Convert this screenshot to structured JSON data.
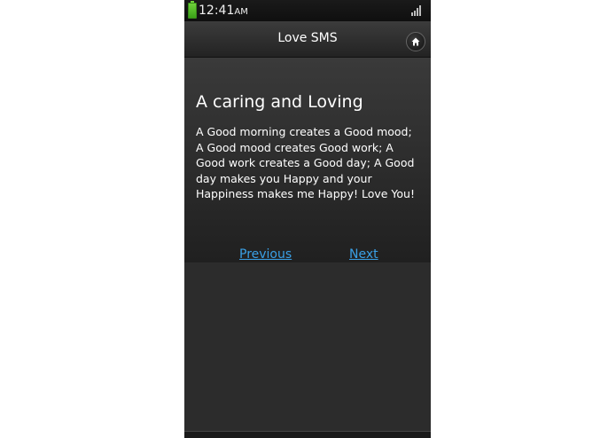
{
  "status_bar": {
    "time": "12:41",
    "ampm": "AM"
  },
  "header": {
    "title": "Love SMS",
    "home_icon": "home-icon"
  },
  "message": {
    "title": "A caring and Loving",
    "body": "A Good morning creates a Good mood; A Good mood creates Good work; A Good work creates a Good day; A Good day makes you Happy and your Happiness makes me Happy! Love You!"
  },
  "navigation": {
    "previous_label": "Previous",
    "next_label": "Next"
  },
  "colors": {
    "link": "#3aa0e6",
    "battery": "#6fd23a"
  }
}
